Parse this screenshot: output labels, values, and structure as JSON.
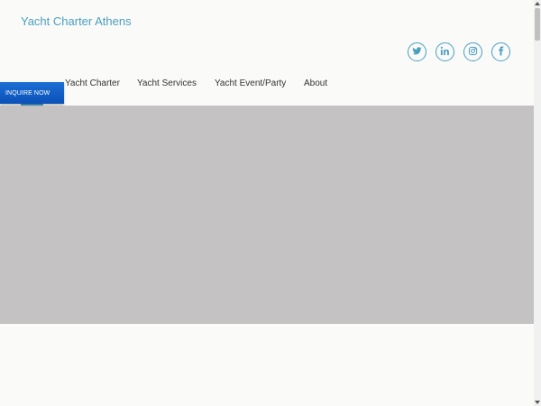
{
  "header": {
    "site_title": "Yacht Charter Athens"
  },
  "social": [
    {
      "icon": "twitter-icon"
    },
    {
      "icon": "linkedin-icon"
    },
    {
      "icon": "instagram-icon"
    },
    {
      "icon": "facebook-icon"
    }
  ],
  "nav": {
    "items": [
      {
        "label": "Yacht Charter"
      },
      {
        "label": "Yacht Services"
      },
      {
        "label": "Yacht Event/Party"
      },
      {
        "label": "About"
      }
    ]
  },
  "inquire_button": {
    "label": "INQUIRE NOW"
  },
  "colors": {
    "accent": "#4a9fc0",
    "inquire_blue": "#0a50b8",
    "hero_gray": "#c4c2c3",
    "background": "#fafaf8"
  }
}
